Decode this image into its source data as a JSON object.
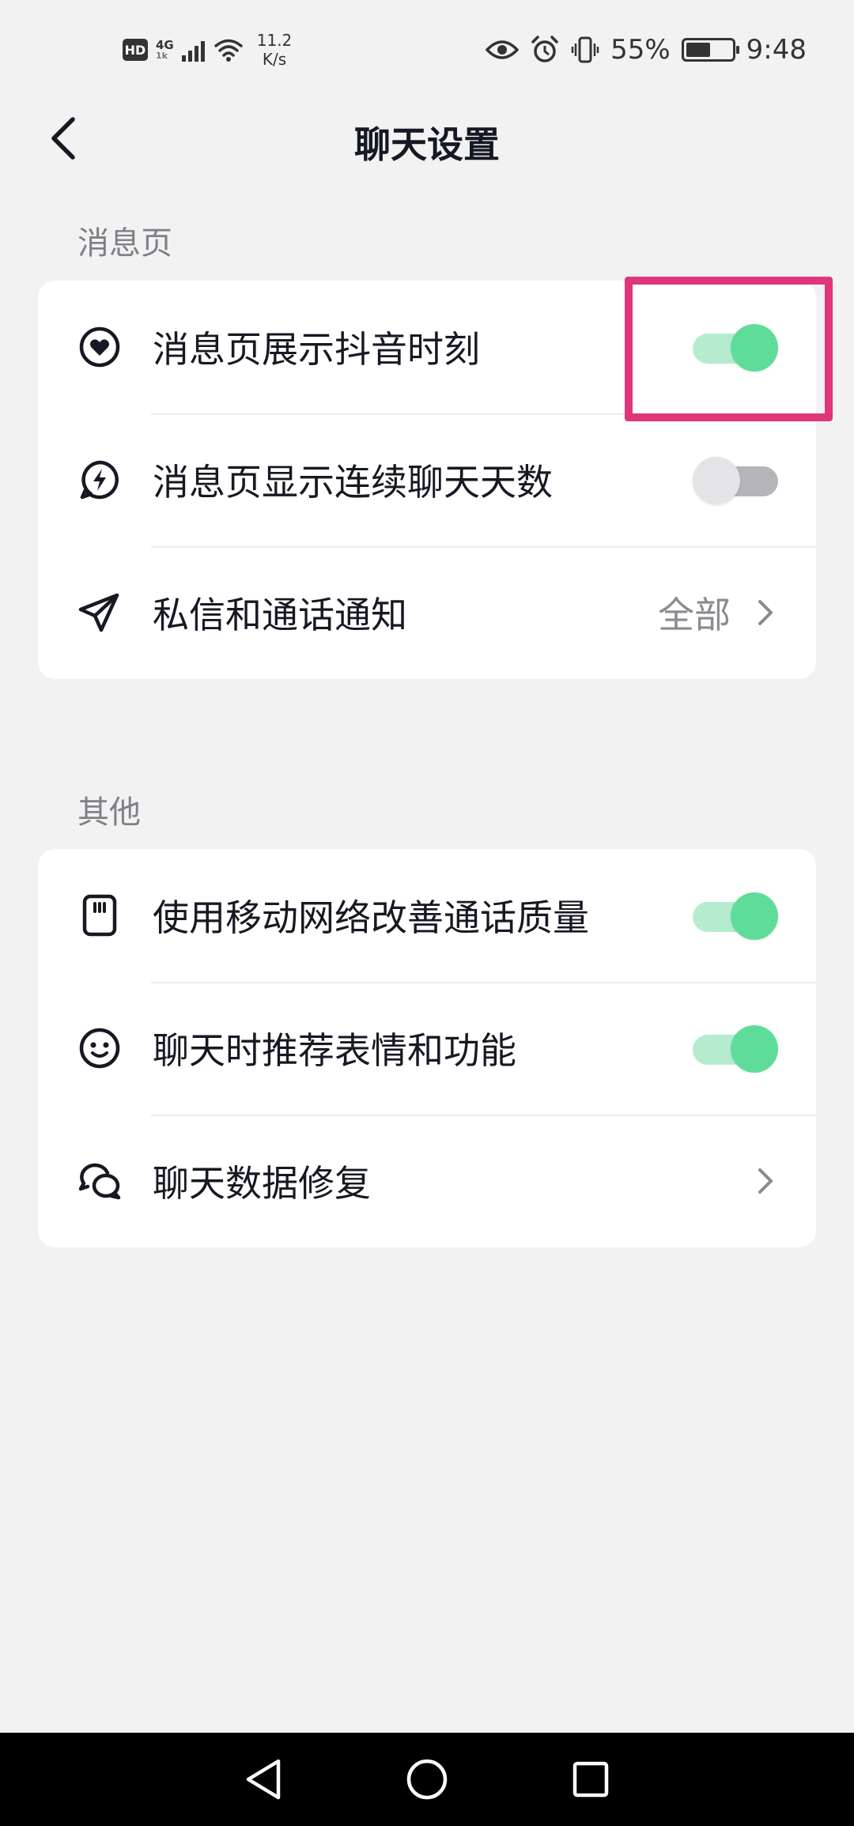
{
  "status_bar": {
    "hd": "HD",
    "network_top": "4G",
    "network_bottom": "1k",
    "speed_value": "11.2",
    "speed_unit": "K/s",
    "battery_percent": "55%",
    "battery_level": 0.55,
    "time": "9:48"
  },
  "header": {
    "title": "聊天设置"
  },
  "sections": [
    {
      "label": "消息页",
      "rows": [
        {
          "label": "消息页展示抖音时刻",
          "icon": "heart-circle-icon",
          "toggle": true
        },
        {
          "label": "消息页显示连续聊天天数",
          "icon": "lightning-chat-icon",
          "toggle": false
        },
        {
          "label": "私信和通话通知",
          "icon": "paper-plane-icon",
          "value": "全部"
        }
      ]
    },
    {
      "label": "其他",
      "rows": [
        {
          "label": "使用移动网络改善通话质量",
          "icon": "sim-card-icon",
          "toggle": true
        },
        {
          "label": "聊天时推荐表情和功能",
          "icon": "smiley-icon",
          "toggle": true
        },
        {
          "label": "聊天数据修复",
          "icon": "chat-bubbles-icon"
        }
      ]
    }
  ],
  "colors": {
    "toggle_on": "#5fdc9a",
    "toggle_off": "#e4e4e7",
    "highlight": "#e0357a",
    "background": "#f2f2f3"
  }
}
